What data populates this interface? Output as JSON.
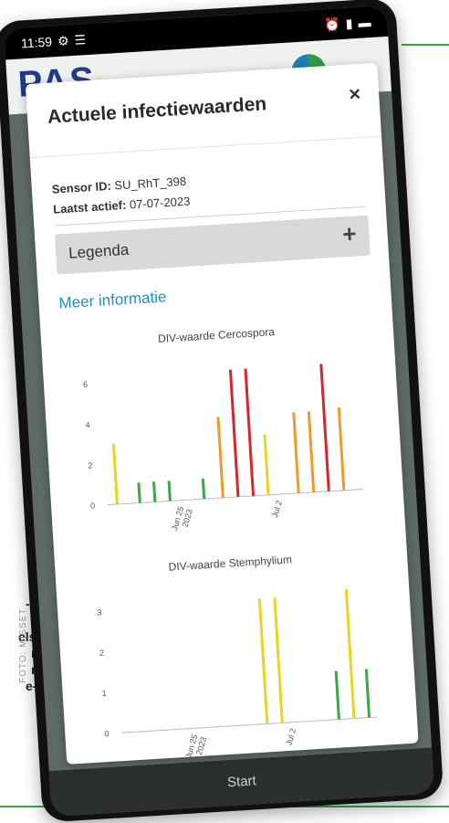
{
  "status_bar": {
    "time": "11:59"
  },
  "app": {
    "logo_text": "PAS"
  },
  "modal": {
    "title": "Actuele infectiewaarden",
    "close_label": "×",
    "sensor_id_label": "Sensor ID:",
    "sensor_id_value": "SU_RhT_398",
    "last_active_label": "Laatst actief:",
    "last_active_value": "07-07-2023",
    "legend_label": "Legenda",
    "legend_toggle": "+",
    "more_info_label": "Meer informatie"
  },
  "bottom_bar": {
    "label": "Start"
  },
  "caption_fragments": [
    "-",
    "els",
    "n",
    "n",
    "e-"
  ],
  "photo_credit": "FOTO: MISSET",
  "colors": {
    "yellow": "#e8d51e",
    "green": "#3aa845",
    "orange": "#ee9a2a",
    "red": "#d6262c",
    "link": "#1f8fc7"
  },
  "chart_data": [
    {
      "type": "bar",
      "title": "DIV-waarde Cercospora",
      "x_tick_labels": [
        "Jun 25\n2023",
        "Jul 2"
      ],
      "y_ticks": [
        0,
        2,
        4,
        6
      ],
      "ylim": [
        0,
        7
      ],
      "bars": [
        {
          "x": 0,
          "value": 3.0,
          "color": "yellow"
        },
        {
          "x": 1.2,
          "value": 1.0,
          "color": "green"
        },
        {
          "x": 2.0,
          "value": 1.0,
          "color": "green"
        },
        {
          "x": 2.8,
          "value": 1.0,
          "color": "green"
        },
        {
          "x": 4.6,
          "value": 1.0,
          "color": "green"
        },
        {
          "x": 5.6,
          "value": 4.0,
          "color": "orange"
        },
        {
          "x": 6.4,
          "value": 6.3,
          "color": "red"
        },
        {
          "x": 7.2,
          "value": 6.3,
          "color": "red"
        },
        {
          "x": 8.0,
          "value": 3.0,
          "color": "yellow"
        },
        {
          "x": 9.6,
          "value": 4.0,
          "color": "orange"
        },
        {
          "x": 10.4,
          "value": 4.0,
          "color": "orange"
        },
        {
          "x": 11.2,
          "value": 6.3,
          "color": "red"
        },
        {
          "x": 12.0,
          "value": 4.1,
          "color": "orange"
        }
      ]
    },
    {
      "type": "bar",
      "title": "DIV-waarde Stemphylium",
      "x_tick_labels": [
        "Jun 25\n2023",
        "Jul 2"
      ],
      "y_ticks": [
        0,
        1,
        2,
        3
      ],
      "ylim": [
        0,
        3.5
      ],
      "bars": [
        {
          "x": 7.2,
          "value": 3.1,
          "color": "yellow"
        },
        {
          "x": 8.0,
          "value": 3.1,
          "color": "yellow"
        },
        {
          "x": 11.0,
          "value": 1.2,
          "color": "green"
        },
        {
          "x": 11.8,
          "value": 3.2,
          "color": "yellow"
        },
        {
          "x": 12.6,
          "value": 1.2,
          "color": "green"
        }
      ]
    }
  ]
}
